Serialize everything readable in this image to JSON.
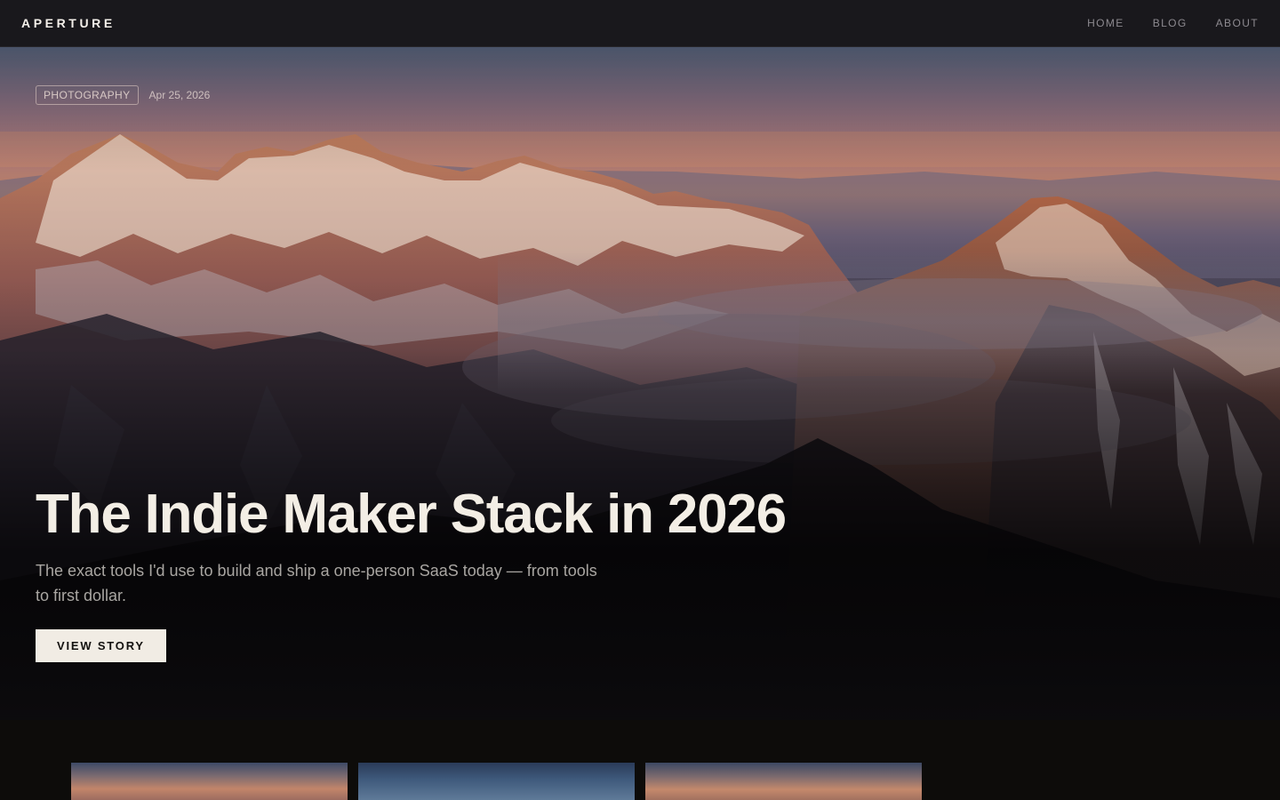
{
  "brand": "APERTURE",
  "nav": {
    "items": [
      "HOME",
      "BLOG",
      "ABOUT"
    ]
  },
  "hero": {
    "tag": "PHOTOGRAPHY",
    "date": "Apr 25, 2026",
    "title": "The Indie Maker Stack in 2026",
    "subtitle": "The exact tools I'd use to build and ship a one-person SaaS today — from tools to first dollar.",
    "cta": "VIEW STORY"
  },
  "colors": {
    "nav_bg": "#19181c",
    "page_bg": "#0d0c0a",
    "title": "#f3eee5",
    "cta_bg": "#f1ece4"
  }
}
